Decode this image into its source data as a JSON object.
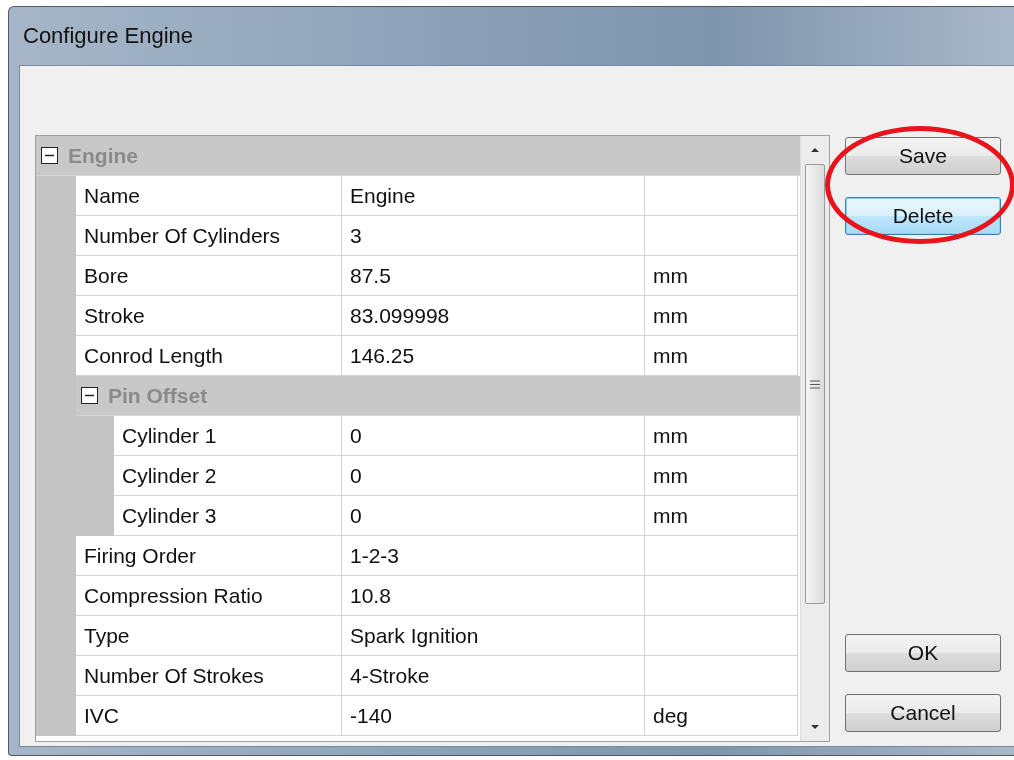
{
  "window": {
    "title": "Configure Engine"
  },
  "grid": {
    "items": [
      {
        "kind": "category",
        "name": "Engine",
        "expanded": true,
        "children": [
          {
            "kind": "property",
            "name": "Name",
            "value": "Engine"
          },
          {
            "kind": "property",
            "name": "Number Of Cylinders",
            "value": "3"
          },
          {
            "kind": "property",
            "name": "Bore",
            "value": "87.5",
            "unit": "mm"
          },
          {
            "kind": "property",
            "name": "Stroke",
            "value": "83.099998",
            "unit": "mm"
          },
          {
            "kind": "property",
            "name": "Conrod Length",
            "value": "146.25",
            "unit": "mm"
          },
          {
            "kind": "category",
            "name": "Pin Offset",
            "expanded": true,
            "children": [
              {
                "kind": "property",
                "name": "Cylinder 1",
                "value": "0",
                "unit": "mm"
              },
              {
                "kind": "property",
                "name": "Cylinder 2",
                "value": "0",
                "unit": "mm"
              },
              {
                "kind": "property",
                "name": "Cylinder 3",
                "value": "0",
                "unit": "mm"
              }
            ]
          },
          {
            "kind": "property",
            "name": "Firing Order",
            "value": "1-2-3"
          },
          {
            "kind": "property",
            "name": "Compression Ratio",
            "value": "10.8"
          },
          {
            "kind": "property",
            "name": "Type",
            "value": "Spark Ignition"
          },
          {
            "kind": "property",
            "name": "Number Of Strokes",
            "value": "4-Stroke"
          },
          {
            "kind": "property",
            "name": "IVC",
            "value": "-140",
            "unit": "deg"
          }
        ]
      }
    ]
  },
  "side_buttons": [
    {
      "label": "Save",
      "focused": false
    },
    {
      "label": "Delete",
      "focused": true
    }
  ],
  "bottom_buttons": [
    {
      "label": "OK",
      "focused": false
    },
    {
      "label": "Cancel",
      "focused": false
    }
  ]
}
